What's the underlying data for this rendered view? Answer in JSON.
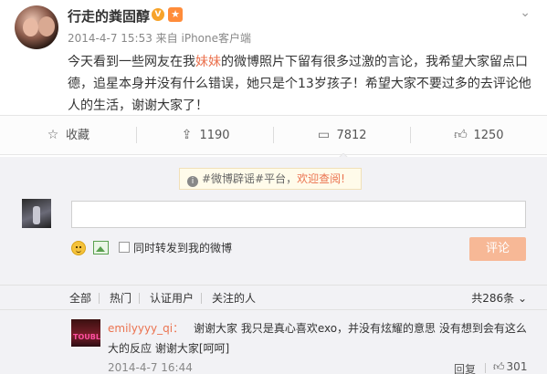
{
  "post": {
    "username": "行走的粪固醇",
    "verified_badge": "V",
    "member_badge": "★",
    "meta": "2014-4-7 15:53 来自 iPhone客户端",
    "dropdown_icon": "chevron-down-icon",
    "content_before": "今天看到一些网友在我",
    "content_highlight": "妹妹",
    "content_after": "的微博照片下留有很多过激的言论，我希望大家留点口德，追星本身并没有什么错误，她只是个13岁孩子！希望大家不要过多的去评论他人的生活，谢谢大家了！",
    "highlight_color": "#eb7350"
  },
  "actions": {
    "favorite_label": "收藏",
    "forward_count": "1190",
    "comment_count": "7812",
    "like_count": "1250"
  },
  "comment_box": {
    "notice_prefix": "#微博辟谣#平台，",
    "notice_link": "欢迎查阅!",
    "input_value": "",
    "repost_label": "同时转发到我的微博",
    "submit_label": "评论",
    "submit_color": "#f7b896"
  },
  "filters": {
    "all": "全部",
    "hot": "热门",
    "verified": "认证用户",
    "following": "关注的人",
    "total": "共286条"
  },
  "comments": [
    {
      "avatar_text": "TOUBL",
      "user": "emilyyyy_qi：",
      "text": "谢谢大家 我只是真心喜欢exo，并没有炫耀的意思 没有想到会有这么大的反应 谢谢大家[呵呵]",
      "time": "2014-4-7 16:44",
      "reply_label": "回复",
      "like_count": "301"
    }
  ]
}
